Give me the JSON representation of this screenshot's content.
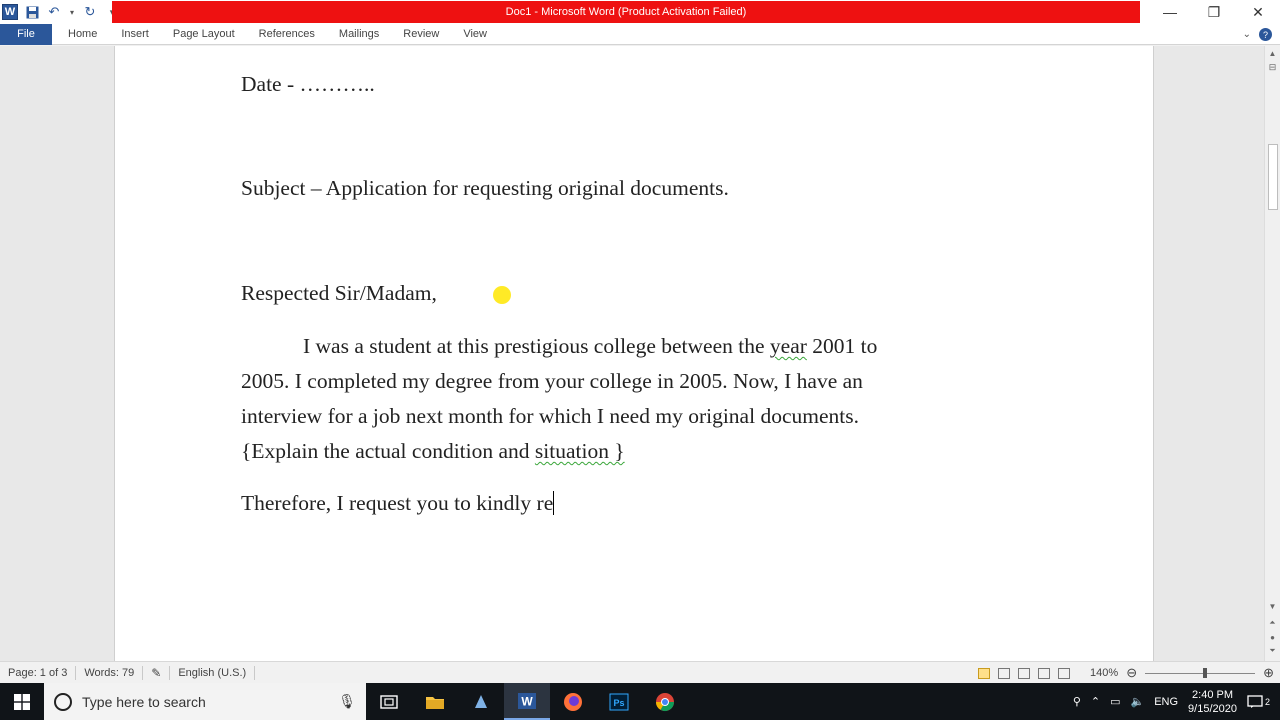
{
  "app": {
    "title": "Doc1  -  Microsoft Word (Product Activation Failed)",
    "logo_letter": "W",
    "title_color": "#ee1111",
    "accent": "#2b579a"
  },
  "ribbon": {
    "file": "File",
    "tabs": [
      "Home",
      "Insert",
      "Page Layout",
      "References",
      "Mailings",
      "Review",
      "View"
    ]
  },
  "document": {
    "date_line": "Date - ………..",
    "subject_line": "Subject – Application for requesting original documents.",
    "salutation": "Respected Sir/Madam,",
    "para1": {
      "l1_a": "I was a student at this prestigious college between the ",
      "l1_word": "year",
      "l1_b": " 2001 to",
      "l2": "2005. I completed my degree from your college in 2005. Now, I have an",
      "l3": "interview for a job next month for which I need my original documents.",
      "l4_a": "{Explain the actual condition and ",
      "l4_word": "situation }"
    },
    "para2": "Therefore, I request you to kindly re"
  },
  "status": {
    "page": "Page: 1 of 3",
    "words": "Words: 79",
    "language": "English (U.S.)",
    "zoom": "140%"
  },
  "taskbar": {
    "search_placeholder": "Type here to search",
    "lang": "ENG",
    "time": "2:40 PM",
    "date": "9/15/2020",
    "notifications": "2"
  }
}
